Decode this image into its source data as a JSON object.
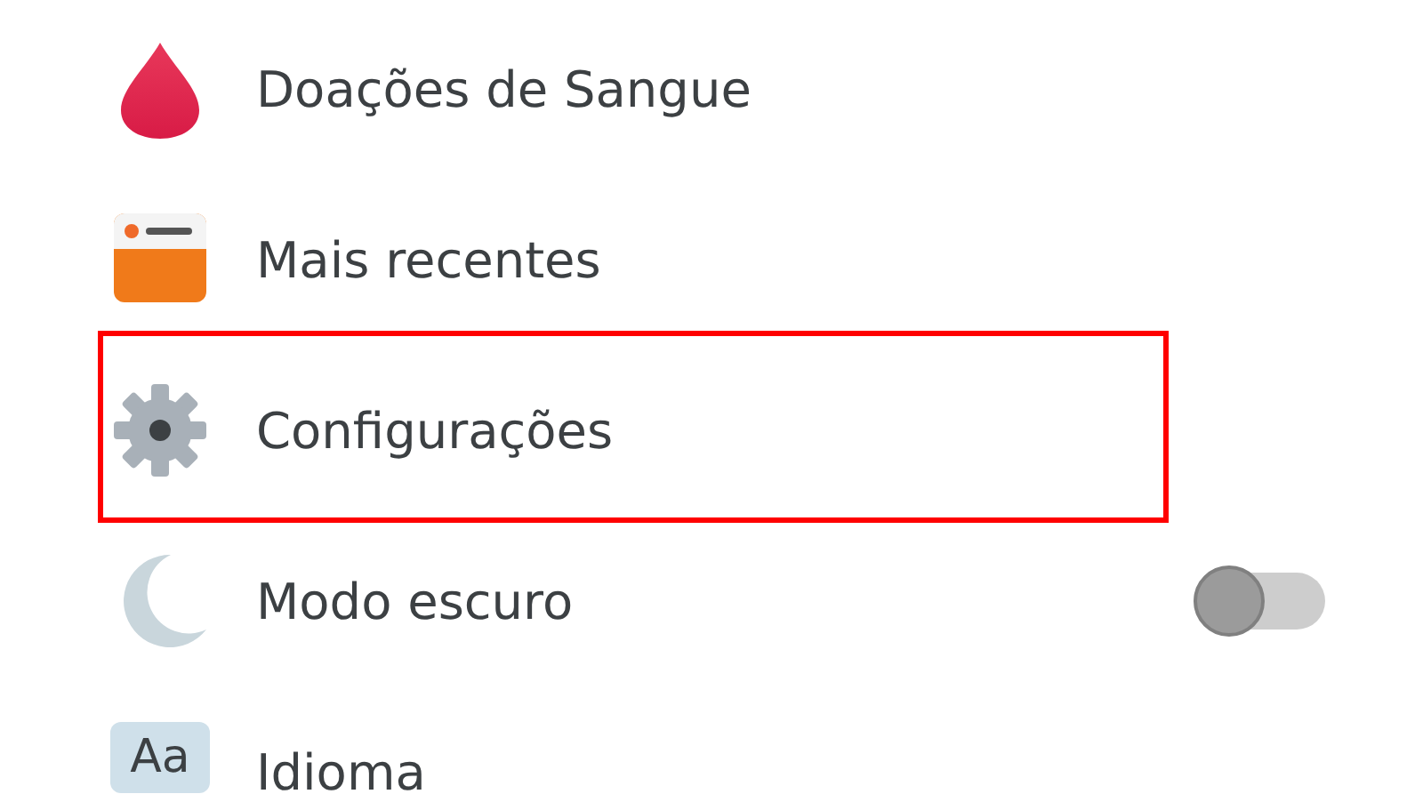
{
  "menu": [
    {
      "label": "Doações de Sangue",
      "highlighted": false
    },
    {
      "label": "Mais recentes",
      "highlighted": false
    },
    {
      "label": "Configurações",
      "highlighted": true
    },
    {
      "label": "Modo escuro",
      "highlighted": false,
      "toggle": {
        "on": false
      }
    },
    {
      "icon_text": "Aa",
      "label": "Idioma",
      "highlighted": false
    }
  ]
}
